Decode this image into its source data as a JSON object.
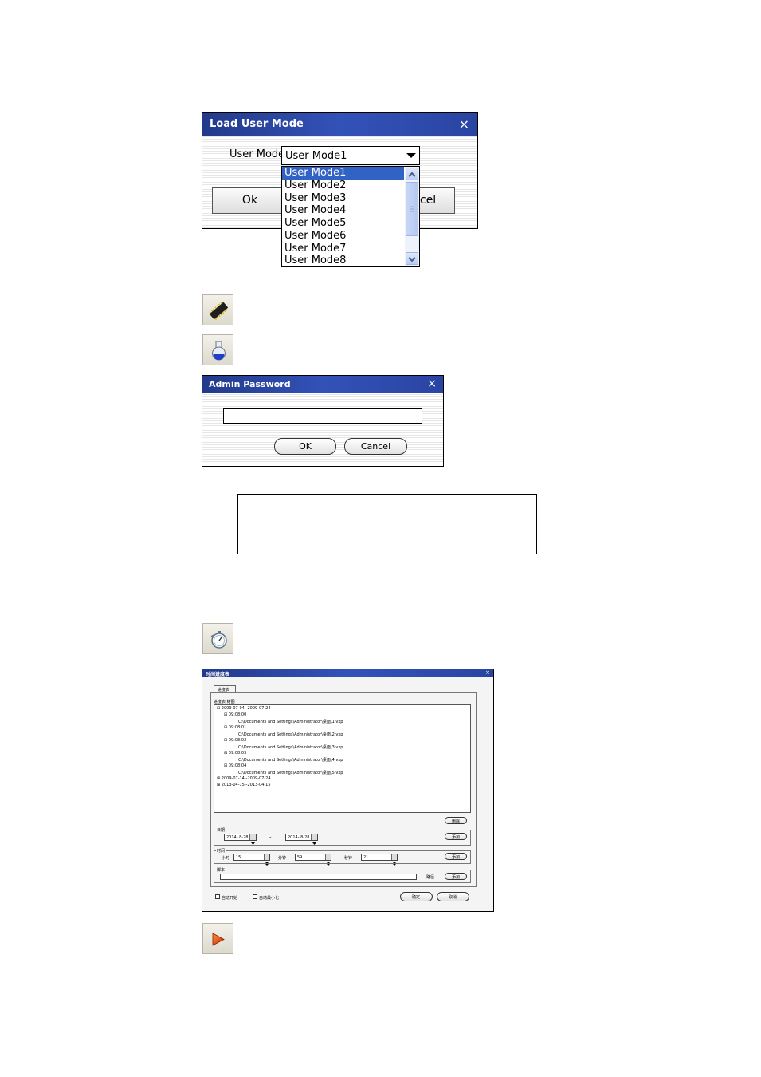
{
  "load_user_mode": {
    "title": "Load User Mode",
    "close_glyph": "×",
    "field_label": "User Mode",
    "selected_value": "User Mode1",
    "options": [
      "User Mode1",
      "User Mode2",
      "User Mode3",
      "User Mode4",
      "User Mode5",
      "User Mode6",
      "User Mode7",
      "User Mode8"
    ],
    "ok_label": "Ok",
    "cancel_label_visible": "cel"
  },
  "icons": {
    "memory": "memory-chip-icon",
    "flask": "flask-icon",
    "timer": "stopwatch-icon",
    "play": "play-icon"
  },
  "admin_password": {
    "title": "Admin Password",
    "close_glyph": "×",
    "password_value": "",
    "ok_label": "OK",
    "cancel_label": "Cancel"
  },
  "schedule": {
    "title": "时间进度表",
    "close_glyph": "×",
    "tab_label": "进度表",
    "tree_header": "进度表 树图",
    "tree": [
      {
        "label": "2009-07-04--2009-07-24",
        "level": 0,
        "sign": "⊟"
      },
      {
        "label": "09:08:00",
        "level": 1,
        "sign": "⊟"
      },
      {
        "label": "C:\\Documents and Settings\\Administrator\\桌面\\1.vxp",
        "level": 2,
        "sign": ""
      },
      {
        "label": "09:08:01",
        "level": 1,
        "sign": "⊟"
      },
      {
        "label": "C:\\Documents and Settings\\Administrator\\桌面\\2.vxp",
        "level": 2,
        "sign": ""
      },
      {
        "label": "09:08:02",
        "level": 1,
        "sign": "⊟"
      },
      {
        "label": "C:\\Documents and Settings\\Administrator\\桌面\\3.vxp",
        "level": 2,
        "sign": ""
      },
      {
        "label": "09:08:03",
        "level": 1,
        "sign": "⊟"
      },
      {
        "label": "C:\\Documents and Settings\\Administrator\\桌面\\4.vxp",
        "level": 2,
        "sign": ""
      },
      {
        "label": "09:08:04",
        "level": 1,
        "sign": "⊟"
      },
      {
        "label": "C:\\Documents and Settings\\Administrator\\桌面\\5.vxp",
        "level": 2,
        "sign": ""
      },
      {
        "label": "2009-07-14--2009-07-24",
        "level": 0,
        "sign": "⊞"
      },
      {
        "label": "2013-04-15--2013-04-15",
        "level": 0,
        "sign": "⊞"
      }
    ],
    "delete_label": "删除",
    "date_group": "日期",
    "date_from": "2014- 8-28",
    "date_to": "2014- 8-28",
    "date_sep": "-",
    "add_label": "添加",
    "time_group": "时间",
    "hour_label": "小时",
    "hour_value": "15",
    "minute_label": "分钟",
    "minute_value": "59",
    "second_label": "秒钟",
    "second_value": "21",
    "script_group": "脚本",
    "script_value": "",
    "path_label": "路径",
    "auto_start_label": "自动开始",
    "auto_minimize_label": "自动最小化",
    "confirm_label": "确定",
    "cancel_label": "取消"
  }
}
